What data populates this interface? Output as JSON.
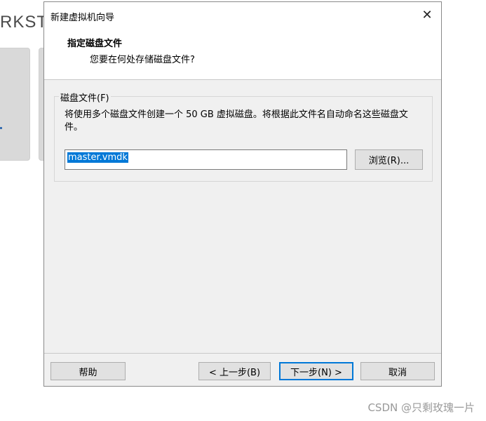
{
  "background": {
    "logo_text": "RKST"
  },
  "dialog": {
    "title": "新建虚拟机向导",
    "header_title": "指定磁盘文件",
    "header_subtitle": "您要在何处存储磁盘文件?",
    "group_label": "磁盘文件(F)",
    "description": "将使用多个磁盘文件创建一个 50 GB 虚拟磁盘。将根据此文件名自动命名这些磁盘文件。",
    "file_name_value": "master.vmdk",
    "browse_label": "浏览(R)...",
    "help_label": "帮助",
    "prev_label": "< 上一步(B)",
    "next_label": "下一步(N) >",
    "cancel_label": "取消",
    "close_glyph": "✕"
  },
  "watermark": "CSDN @只剩玫瑰一片",
  "colors": {
    "accent": "#0078d7",
    "dialog_bg": "#f0f0f0"
  }
}
